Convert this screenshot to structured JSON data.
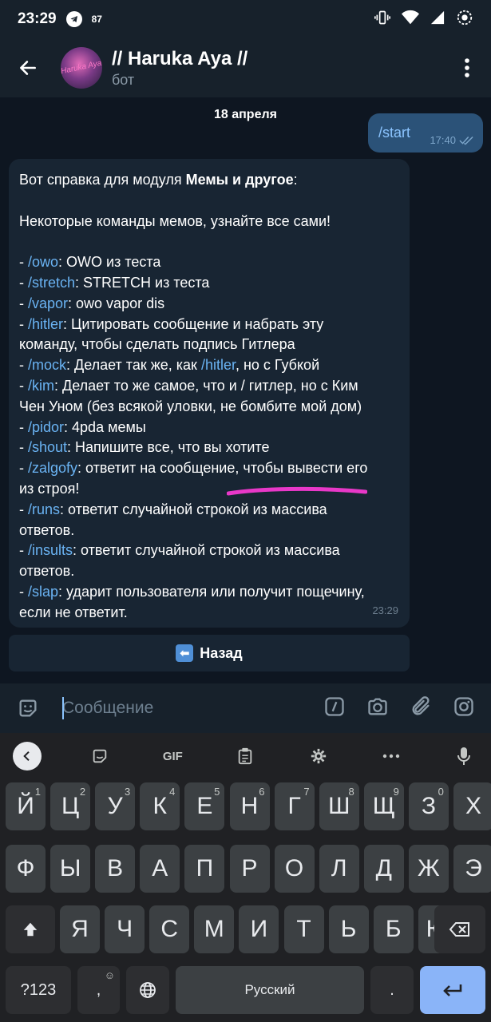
{
  "status": {
    "time": "23:29",
    "notif_count": "87"
  },
  "header": {
    "title": "// Haruka Aya //",
    "subtitle": "бот",
    "avatar_text": "Haruka Aya"
  },
  "chat": {
    "date": "18 апреля",
    "outgoing": {
      "text": "/start",
      "time": "17:40"
    },
    "incoming": {
      "time": "23:29",
      "intro_prefix": "Вот справка для модуля ",
      "intro_bold": "Мемы и другое",
      "intro_suffix": ":",
      "subtitle": "Некоторые команды мемов, узнайте все сами!",
      "lines": [
        [
          {
            "t": "- "
          },
          {
            "c": "/owo"
          },
          {
            "t": ": OWO из теста"
          }
        ],
        [
          {
            "t": "- "
          },
          {
            "c": "/stretch"
          },
          {
            "t": ": STRETCH из теста"
          }
        ],
        [
          {
            "t": "- "
          },
          {
            "c": "/vapor"
          },
          {
            "t": ": owo vapor dis"
          }
        ],
        [
          {
            "t": "- "
          },
          {
            "c": "/hitler"
          },
          {
            "t": ": Цитировать сообщение и набрать эту"
          }
        ],
        [
          {
            "t": "команду, чтобы сделать подпись Гитлера"
          }
        ],
        [
          {
            "t": "- "
          },
          {
            "c": "/mock"
          },
          {
            "t": ": Делает так же, как "
          },
          {
            "c": "/hitler"
          },
          {
            "t": ", но с Губкой"
          }
        ],
        [
          {
            "t": "- "
          },
          {
            "c": "/kim"
          },
          {
            "t": ": Делает то же самое, что и / гитлер, но с Ким"
          }
        ],
        [
          {
            "t": "Чен Уном (без всякой уловки, не бомбите мой дом)"
          }
        ],
        [
          {
            "t": "- "
          },
          {
            "c": "/pidor"
          },
          {
            "t": ": 4pda мемы"
          }
        ],
        [
          {
            "t": "- "
          },
          {
            "c": "/shout"
          },
          {
            "t": ": Напишите все, что вы хотите"
          }
        ],
        [
          {
            "t": "- "
          },
          {
            "c": "/zalgofy"
          },
          {
            "t": ": ответит на сообщение, чтобы вывести его"
          }
        ],
        [
          {
            "t": "из строя!"
          }
        ],
        [
          {
            "t": "- "
          },
          {
            "c": "/runs"
          },
          {
            "t": ": ответит случайной строкой из массива"
          }
        ],
        [
          {
            "t": "ответов."
          }
        ],
        [
          {
            "t": "- "
          },
          {
            "c": "/insults"
          },
          {
            "t": ": ответит случайной строкой из массива"
          }
        ],
        [
          {
            "t": "ответов."
          }
        ],
        [
          {
            "t": "- "
          },
          {
            "c": "/slap"
          },
          {
            "t": ": ударит пользователя или получит пощечину,"
          }
        ],
        [
          {
            "t": "если не ответит."
          }
        ]
      ]
    },
    "inline_button": "Назад"
  },
  "input": {
    "placeholder": "Сообщение"
  },
  "keyboard": {
    "toolbar": {
      "gif_label": "GIF"
    },
    "row1": [
      [
        "Й",
        "1"
      ],
      [
        "Ц",
        "2"
      ],
      [
        "У",
        "3"
      ],
      [
        "К",
        "4"
      ],
      [
        "Е",
        "5"
      ],
      [
        "Н",
        "6"
      ],
      [
        "Г",
        "7"
      ],
      [
        "Ш",
        "8"
      ],
      [
        "Щ",
        "9"
      ],
      [
        "З",
        "0"
      ],
      [
        "Х",
        ""
      ]
    ],
    "row2": [
      "Ф",
      "Ы",
      "В",
      "А",
      "П",
      "Р",
      "О",
      "Л",
      "Д",
      "Ж",
      "Э"
    ],
    "row3": [
      "Я",
      "Ч",
      "С",
      "М",
      "И",
      "Т",
      "Ь",
      "Б",
      "Ю"
    ],
    "symbols_label": "?123",
    "comma_label": ",",
    "space_label": "Русский",
    "period_label": "."
  },
  "colors": {
    "accent": "#6ab3f3",
    "highlight": "#e838c8"
  }
}
